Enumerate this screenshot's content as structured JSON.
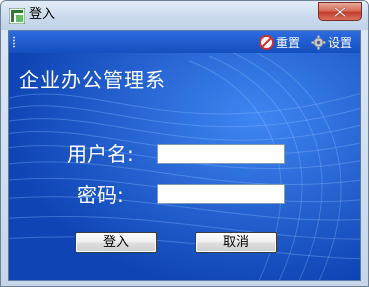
{
  "window": {
    "title": "登入",
    "close_symbol": "✕"
  },
  "toolbar": {
    "reset_label": "重置",
    "settings_label": "设置"
  },
  "main": {
    "app_title": "企业办公管理系",
    "username_label": "用户名:",
    "username_value": "",
    "password_label": "密码:",
    "password_value": "",
    "login_button": "登入",
    "cancel_button": "取消"
  },
  "icons": {
    "app": "app-icon",
    "close": "close-icon",
    "reset": "reset-icon",
    "settings": "gear-icon"
  },
  "colors": {
    "client_background": "#1a58c8",
    "close_button": "#c43f2b",
    "label_text": "#ffffff"
  }
}
